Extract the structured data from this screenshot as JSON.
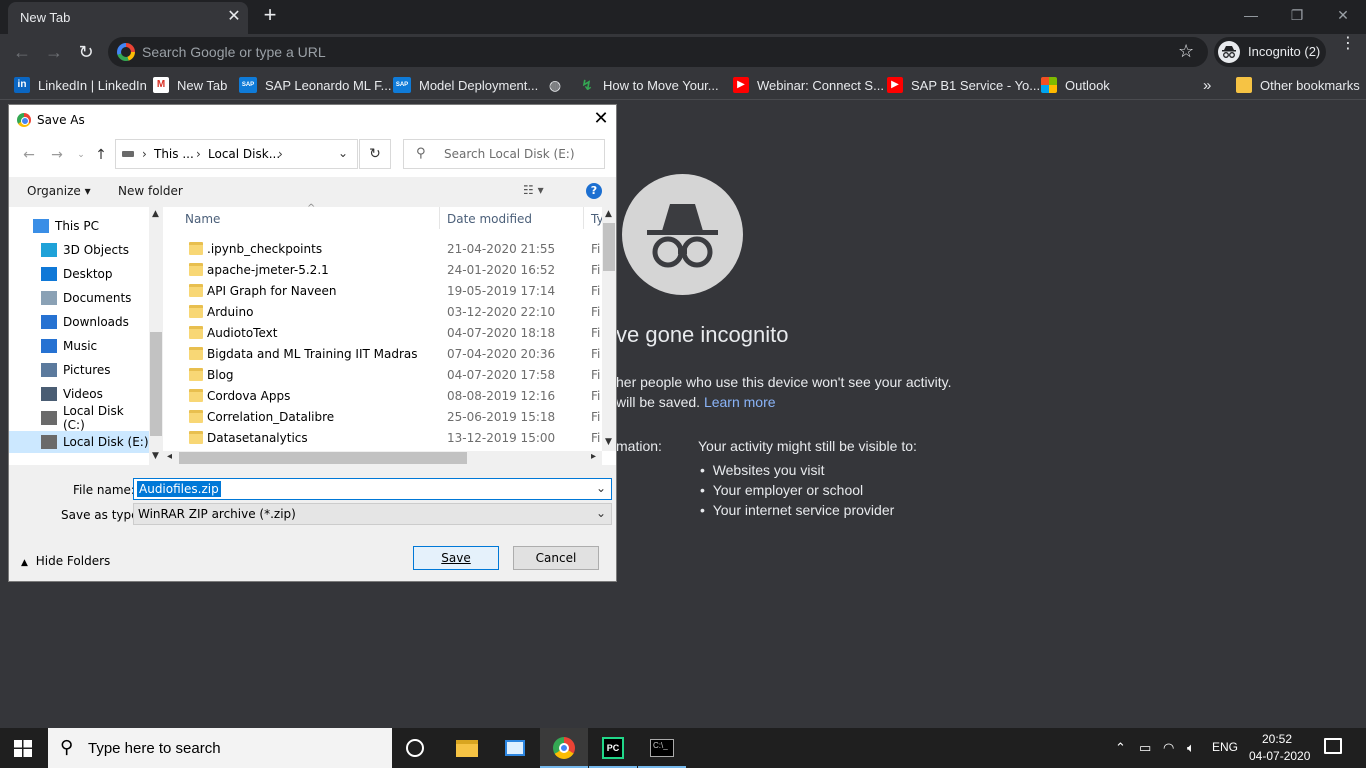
{
  "browser": {
    "tab_title": "New Tab",
    "tab_close": "✕",
    "new_tab": "+",
    "window_min": "—",
    "window_restore": "❐",
    "window_close": "✕",
    "back": "←",
    "forward": "→",
    "reload": "↻",
    "omnibox_placeholder": "Search Google or type a URL",
    "star": "☆",
    "incognito_label": "Incognito (2)",
    "menu": "⋮"
  },
  "bookmarks": [
    {
      "label": "LinkedIn | LinkedIn",
      "icon": "linkedin-icon",
      "color": "#0a66c2",
      "glyph": "in"
    },
    {
      "label": "New Tab",
      "icon": "gmail-icon",
      "color": "#ffffff",
      "glyph": "M"
    },
    {
      "label": "SAP Leonardo ML F...",
      "icon": "sap-icon",
      "color": "#0f7bd8",
      "glyph": "SAP"
    },
    {
      "label": "Model Deployment...",
      "icon": "sap-icon",
      "color": "#0f7bd8",
      "glyph": "SAP"
    },
    {
      "label": "",
      "icon": "globe-icon",
      "color": "#e8eaed",
      "glyph": "◍"
    },
    {
      "label": "How to Move Your...",
      "icon": "bookmark-site-icon",
      "color": "#34a853",
      "glyph": "↯"
    },
    {
      "label": "Webinar: Connect S...",
      "icon": "youtube-icon",
      "color": "#ff0000",
      "glyph": "▶"
    },
    {
      "label": "SAP B1 Service - Yo...",
      "icon": "youtube-icon",
      "color": "#ff0000",
      "glyph": "▶"
    },
    {
      "label": "Outlook",
      "icon": "microsoft-icon",
      "color": "#f25022",
      "glyph": ""
    }
  ],
  "bookmarks_more": "»",
  "other_bookmarks": "Other bookmarks",
  "incognito_page": {
    "heading": "ve gone incognito",
    "line1": "her people who use this device won't see your activity.",
    "line2": "will be saved.",
    "learn_more": "Learn more",
    "info_label": "mation:",
    "visible_heading": "Your activity might still be visible to:",
    "bullets": [
      "Websites you visit",
      "Your employer or school",
      "Your internet service provider"
    ]
  },
  "dialog": {
    "title": "Save As",
    "close": "✕",
    "path": [
      "This ...",
      "Local Disk..."
    ],
    "search_placeholder": "Search Local Disk (E:)",
    "organize": "Organize ▾",
    "new_folder": "New folder",
    "help": "?",
    "nav_tree": [
      {
        "label": "This PC",
        "icon": "this-pc-icon",
        "color": "#3a8ee6",
        "selected": false,
        "indent": 0
      },
      {
        "label": "3D Objects",
        "icon": "3d-objects-icon",
        "color": "#1fa2d8",
        "selected": false,
        "indent": 1
      },
      {
        "label": "Desktop",
        "icon": "desktop-icon",
        "color": "#0f78d7",
        "selected": false,
        "indent": 1
      },
      {
        "label": "Documents",
        "icon": "documents-icon",
        "color": "#8aa1b5",
        "selected": false,
        "indent": 1
      },
      {
        "label": "Downloads",
        "icon": "downloads-icon",
        "color": "#2672d2",
        "selected": false,
        "indent": 1
      },
      {
        "label": "Music",
        "icon": "music-icon",
        "color": "#2672d2",
        "selected": false,
        "indent": 1
      },
      {
        "label": "Pictures",
        "icon": "pictures-icon",
        "color": "#5b7a9d",
        "selected": false,
        "indent": 1
      },
      {
        "label": "Videos",
        "icon": "videos-icon",
        "color": "#4a5d73",
        "selected": false,
        "indent": 1
      },
      {
        "label": "Local Disk (C:)",
        "icon": "drive-c-icon",
        "color": "#6a6a6a",
        "selected": false,
        "indent": 1
      },
      {
        "label": "Local Disk (E:)",
        "icon": "drive-e-icon",
        "color": "#6a6a6a",
        "selected": true,
        "indent": 1
      }
    ],
    "columns": {
      "name": "Name",
      "date": "Date modified",
      "type": "Ty"
    },
    "files": [
      {
        "name": ".ipynb_checkpoints",
        "date": "21-04-2020 21:55",
        "type": "Fi"
      },
      {
        "name": "apache-jmeter-5.2.1",
        "date": "24-01-2020 16:52",
        "type": "Fi"
      },
      {
        "name": "API Graph for Naveen",
        "date": "19-05-2019 17:14",
        "type": "Fi"
      },
      {
        "name": "Arduino",
        "date": "03-12-2020 22:10",
        "type": "Fi"
      },
      {
        "name": "AudiotoText",
        "date": "04-07-2020 18:18",
        "type": "Fi"
      },
      {
        "name": "Bigdata and ML Training IIT Madras",
        "date": "07-04-2020 20:36",
        "type": "Fi"
      },
      {
        "name": "Blog",
        "date": "04-07-2020 17:58",
        "type": "Fi"
      },
      {
        "name": "Cordova Apps",
        "date": "08-08-2019 12:16",
        "type": "Fi"
      },
      {
        "name": "Correlation_Datalibre",
        "date": "25-06-2019 15:18",
        "type": "Fi"
      },
      {
        "name": "Datasetanalytics",
        "date": "13-12-2019 15:00",
        "type": "Fi"
      }
    ],
    "file_name_label": "File name:",
    "file_name_value": "Audiofiles.zip",
    "save_type_label": "Save as type:",
    "save_type_value": "WinRAR ZIP archive (*.zip)",
    "hide_folders": "Hide Folders",
    "save_button": "Save",
    "cancel_button": "Cancel"
  },
  "taskbar": {
    "search_placeholder": "Type here to search",
    "language": "ENG",
    "time": "20:52",
    "date": "04-07-2020"
  }
}
